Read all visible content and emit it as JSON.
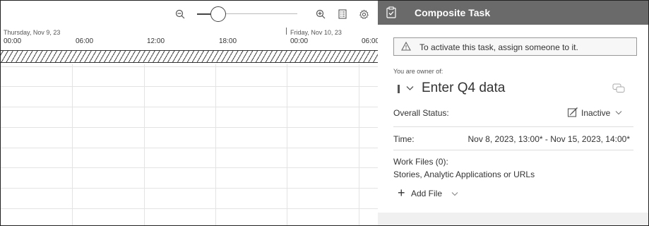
{
  "timeline": {
    "toolbar": {
      "zoom_out_icon": "zoom-out-icon",
      "zoom_in_icon": "zoom-in-icon",
      "list_icon": "list-icon",
      "settings_icon": "gear-icon",
      "zoom_level": 0.15
    },
    "days": [
      {
        "label": "Thursday, Nov 9, 23"
      },
      {
        "label": "Friday, Nov 10, 23"
      }
    ],
    "ticks": [
      "00:00",
      "06:00",
      "12:00",
      "18:00",
      "00:00",
      "06:00"
    ]
  },
  "panel": {
    "title": "Composite Task",
    "warning": "To activate this task, assign someone to it.",
    "owner_label": "You are owner of:",
    "task_name": "Enter Q4 data",
    "overall_status_label": "Overall Status:",
    "overall_status_value": "Inactive",
    "time_label": "Time:",
    "time_value": "Nov 8, 2023, 13:00* - Nov 15, 2023, 14:00*",
    "work_files_label": "Work Files (0):",
    "work_files_sub": "Stories, Analytic Applications or URLs",
    "add_file_label": "Add File"
  },
  "colors": {
    "header_bg": "#6a6a6a",
    "panel_bg": "#f3f3f3",
    "grid_line": "#e3e3e3"
  }
}
